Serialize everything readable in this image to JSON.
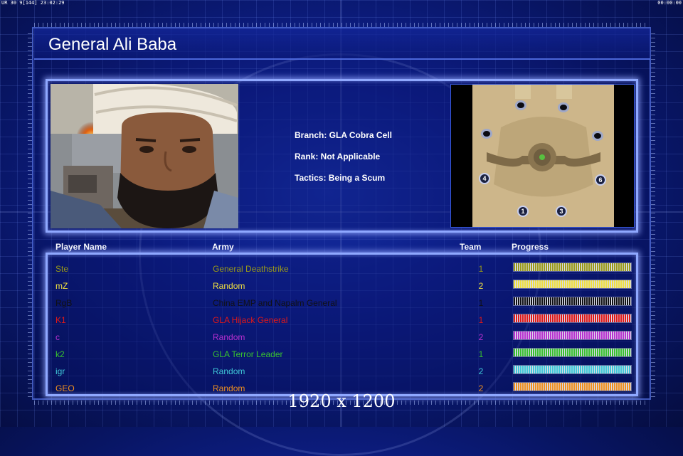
{
  "status_bar": {
    "left_text": "UR 30 9[144] 23:02:29",
    "right_text": "00:00:00"
  },
  "title": "General Ali Baba",
  "general_info": {
    "branch": "Branch: GLA Cobra Cell",
    "rank": "Rank: Not Applicable",
    "tactics": "Tactics: Being a Scum"
  },
  "minimap": {
    "spawn_labels": [
      "4",
      "6",
      "1",
      "3"
    ]
  },
  "roster": {
    "headers": {
      "player": "Player Name",
      "army": "Army",
      "team": "Team",
      "progress": "Progress"
    },
    "players": [
      {
        "name": "Ste",
        "army": "General Deathstrike",
        "team": "1",
        "color": "#9a9a18",
        "progress": 1.0
      },
      {
        "name": "mZ",
        "army": "Random",
        "team": "2",
        "color": "#f0e040",
        "progress": 1.0
      },
      {
        "name": "RgB",
        "army": "China EMP and Napalm General",
        "team": "1",
        "color": "#101014",
        "progress": 1.0
      },
      {
        "name": "K1",
        "army": "GLA Hijack General",
        "team": "1",
        "color": "#e01818",
        "progress": 1.0
      },
      {
        "name": "c",
        "army": "Random",
        "team": "2",
        "color": "#b830d0",
        "progress": 1.0
      },
      {
        "name": "k2",
        "army": "GLA Terror Leader",
        "team": "1",
        "color": "#38c030",
        "progress": 1.0
      },
      {
        "name": "igr",
        "army": "Random",
        "team": "2",
        "color": "#40c8d8",
        "progress": 1.0
      },
      {
        "name": "GEO",
        "army": "Random",
        "team": "2",
        "color": "#f09020",
        "progress": 1.0
      }
    ]
  },
  "watermark": "1920 x 1200"
}
